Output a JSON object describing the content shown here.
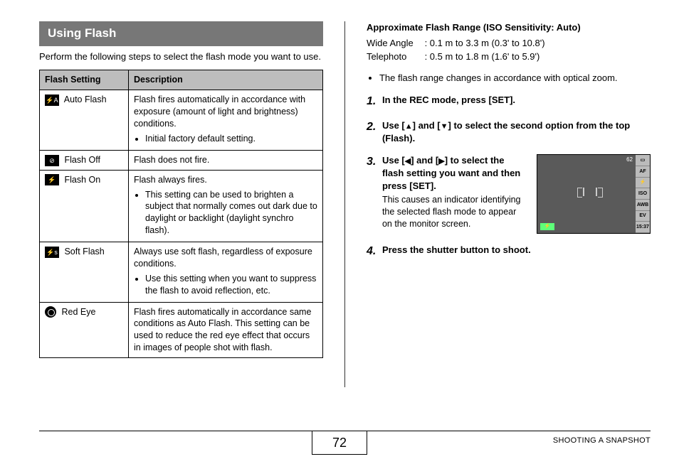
{
  "section_title": "Using Flash",
  "intro_text": "Perform the following steps to select the flash mode you want to use.",
  "table": {
    "head_setting": "Flash Setting",
    "head_desc": "Description",
    "rows": [
      {
        "icon_text": "⚡A",
        "icon_variant": "black",
        "name": "Auto Flash",
        "desc": "Flash fires automatically in accordance with exposure (amount of light and brightness) conditions.",
        "bullets": [
          "Initial factory default setting."
        ]
      },
      {
        "icon_text": "⊘",
        "icon_variant": "black",
        "name": "Flash Off",
        "desc": "Flash does not fire.",
        "bullets": []
      },
      {
        "icon_text": "⚡",
        "icon_variant": "black",
        "name": "Flash On",
        "desc": "Flash always fires.",
        "bullets": [
          "This setting can be used to brighten a subject that normally comes out dark due to daylight or backlight (daylight synchro flash)."
        ]
      },
      {
        "icon_text": "⚡s",
        "icon_variant": "black",
        "name": "Soft Flash",
        "desc": "Always use soft flash, regardless of exposure conditions.",
        "bullets": [
          "Use this setting when you want to suppress the flash to avoid reflection, etc."
        ]
      },
      {
        "icon_text": "",
        "icon_variant": "eye",
        "name": "Red Eye",
        "desc": "Flash fires automatically in accordance same conditions as Auto Flash. This setting can be used to reduce the red eye effect that occurs in images of people shot with flash.",
        "bullets": []
      }
    ]
  },
  "range": {
    "title": "Approximate Flash Range (ISO Sensitivity: Auto)",
    "wide_label": "Wide Angle",
    "wide_value": ": 0.1 m to 3.3 m (0.3' to 10.8')",
    "tele_label": "Telephoto",
    "tele_value": ": 0.5 m to 1.8 m (1.6' to 5.9')"
  },
  "note": "The flash range changes in accordance with optical zoom.",
  "steps": [
    {
      "num": "1.",
      "head": "In the REC mode, press [SET].",
      "sub": ""
    },
    {
      "num": "2.",
      "head_pre": "Use [",
      "head_mid": "] and [",
      "head_post": "] to select the second option from the top (Flash).",
      "dir1": "▲",
      "dir2": "▼",
      "sub": ""
    },
    {
      "num": "3.",
      "head_pre": "Use [",
      "head_mid": "] and [",
      "head_post": "] to select the flash setting you want and then press [SET].",
      "dir1": "◀",
      "dir2": "▶",
      "sub": "This causes an indicator identifying the selected flash mode to appear on the monitor screen."
    },
    {
      "num": "4.",
      "head": "Press the shutter button to shoot.",
      "sub": ""
    }
  ],
  "lcd": {
    "top_num": "62",
    "side": [
      "▭",
      "AF",
      "⚡",
      "ISO",
      "AWB",
      "EV",
      "15:37"
    ],
    "flash_ind": "⚡"
  },
  "footer": {
    "page_num": "72",
    "chapter": "SHOOTING A SNAPSHOT"
  }
}
